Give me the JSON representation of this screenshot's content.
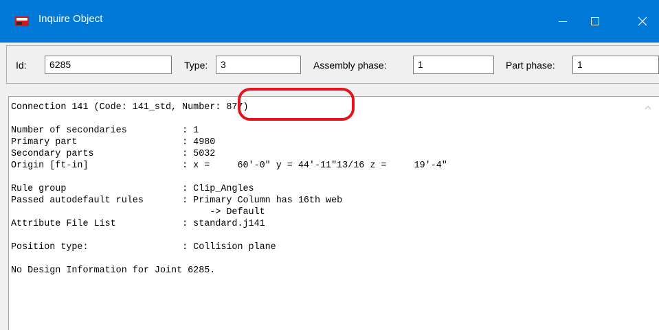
{
  "window": {
    "title": "Inquire Object",
    "icons": {
      "app": "app-window-icon",
      "minimize": "minimize-icon",
      "maximize": "maximize-icon",
      "close": "close-icon"
    }
  },
  "toolbar": {
    "id_label": "Id:",
    "id_value": "6285",
    "type_label": "Type:",
    "type_value": "3",
    "assembly_phase_label": "Assembly phase:",
    "assembly_phase_value": "1",
    "part_phase_label": "Part phase:",
    "part_phase_value": "1"
  },
  "report": {
    "lines": [
      "Connection 141 (Code: 141_std, Number: 877)",
      "",
      "Number of secondaries          : 1",
      "Primary part                   : 4980",
      "Secondary parts                : 5032",
      "Origin [ft-in]                 : x =     60'-0\" y = 44'-11\"13/16 z =     19'-4\"",
      "",
      "Rule group                     : Clip_Angles",
      "Passed autodefault rules       : Primary Column has 16th web",
      "                                    -> Default",
      "Attribute File List            : standard.j141",
      "",
      "Position type:                 : Collision plane",
      "",
      "No Design Information for Joint 6285."
    ]
  },
  "colors": {
    "titlebar": "#0078d7",
    "highlight": "#e3141c"
  }
}
